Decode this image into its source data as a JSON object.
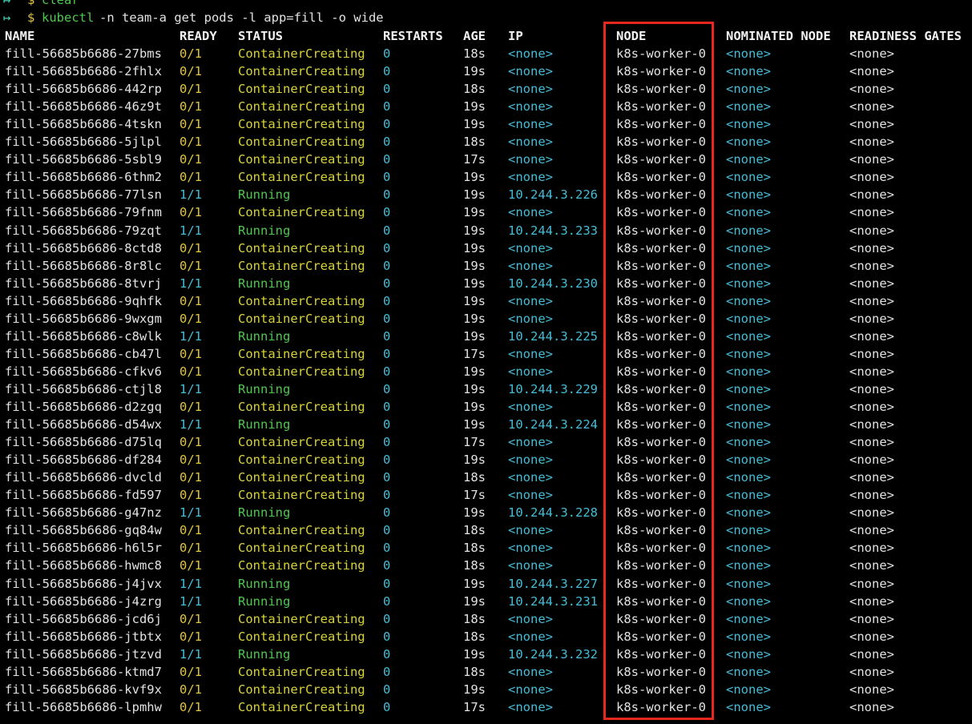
{
  "terminal": {
    "prev_command": {
      "arrow": "↦",
      "dollar": "$",
      "text": "clear"
    },
    "command": {
      "arrow": "↦",
      "dollar": "$",
      "program": "kubectl",
      "args": "-n team-a get pods -l app=fill -o wide"
    },
    "headers": {
      "name": "NAME",
      "ready": "READY",
      "status": "STATUS",
      "restarts": "RESTARTS",
      "age": "AGE",
      "ip": "IP",
      "node": "NODE",
      "nominated_node": "NOMINATED NODE",
      "readiness_gates": "READINESS GATES"
    },
    "highlight_color": "#e8281e",
    "rows": [
      {
        "name": "fill-56685b6686-27bms",
        "ready": "0/1",
        "status": "ContainerCreating",
        "restarts": "0",
        "age": "18s",
        "ip": "<none>",
        "node": "k8s-worker-0",
        "nominated": "<none>",
        "gates": "<none>"
      },
      {
        "name": "fill-56685b6686-2fhlx",
        "ready": "0/1",
        "status": "ContainerCreating",
        "restarts": "0",
        "age": "19s",
        "ip": "<none>",
        "node": "k8s-worker-0",
        "nominated": "<none>",
        "gates": "<none>"
      },
      {
        "name": "fill-56685b6686-442rp",
        "ready": "0/1",
        "status": "ContainerCreating",
        "restarts": "0",
        "age": "18s",
        "ip": "<none>",
        "node": "k8s-worker-0",
        "nominated": "<none>",
        "gates": "<none>"
      },
      {
        "name": "fill-56685b6686-46z9t",
        "ready": "0/1",
        "status": "ContainerCreating",
        "restarts": "0",
        "age": "19s",
        "ip": "<none>",
        "node": "k8s-worker-0",
        "nominated": "<none>",
        "gates": "<none>"
      },
      {
        "name": "fill-56685b6686-4tskn",
        "ready": "0/1",
        "status": "ContainerCreating",
        "restarts": "0",
        "age": "19s",
        "ip": "<none>",
        "node": "k8s-worker-0",
        "nominated": "<none>",
        "gates": "<none>"
      },
      {
        "name": "fill-56685b6686-5jlpl",
        "ready": "0/1",
        "status": "ContainerCreating",
        "restarts": "0",
        "age": "18s",
        "ip": "<none>",
        "node": "k8s-worker-0",
        "nominated": "<none>",
        "gates": "<none>"
      },
      {
        "name": "fill-56685b6686-5sbl9",
        "ready": "0/1",
        "status": "ContainerCreating",
        "restarts": "0",
        "age": "17s",
        "ip": "<none>",
        "node": "k8s-worker-0",
        "nominated": "<none>",
        "gates": "<none>"
      },
      {
        "name": "fill-56685b6686-6thm2",
        "ready": "0/1",
        "status": "ContainerCreating",
        "restarts": "0",
        "age": "19s",
        "ip": "<none>",
        "node": "k8s-worker-0",
        "nominated": "<none>",
        "gates": "<none>"
      },
      {
        "name": "fill-56685b6686-77lsn",
        "ready": "1/1",
        "status": "Running",
        "restarts": "0",
        "age": "19s",
        "ip": "10.244.3.226",
        "node": "k8s-worker-0",
        "nominated": "<none>",
        "gates": "<none>"
      },
      {
        "name": "fill-56685b6686-79fnm",
        "ready": "0/1",
        "status": "ContainerCreating",
        "restarts": "0",
        "age": "19s",
        "ip": "<none>",
        "node": "k8s-worker-0",
        "nominated": "<none>",
        "gates": "<none>"
      },
      {
        "name": "fill-56685b6686-79zqt",
        "ready": "1/1",
        "status": "Running",
        "restarts": "0",
        "age": "19s",
        "ip": "10.244.3.233",
        "node": "k8s-worker-0",
        "nominated": "<none>",
        "gates": "<none>"
      },
      {
        "name": "fill-56685b6686-8ctd8",
        "ready": "0/1",
        "status": "ContainerCreating",
        "restarts": "0",
        "age": "19s",
        "ip": "<none>",
        "node": "k8s-worker-0",
        "nominated": "<none>",
        "gates": "<none>"
      },
      {
        "name": "fill-56685b6686-8r8lc",
        "ready": "0/1",
        "status": "ContainerCreating",
        "restarts": "0",
        "age": "19s",
        "ip": "<none>",
        "node": "k8s-worker-0",
        "nominated": "<none>",
        "gates": "<none>"
      },
      {
        "name": "fill-56685b6686-8tvrj",
        "ready": "1/1",
        "status": "Running",
        "restarts": "0",
        "age": "19s",
        "ip": "10.244.3.230",
        "node": "k8s-worker-0",
        "nominated": "<none>",
        "gates": "<none>"
      },
      {
        "name": "fill-56685b6686-9qhfk",
        "ready": "0/1",
        "status": "ContainerCreating",
        "restarts": "0",
        "age": "19s",
        "ip": "<none>",
        "node": "k8s-worker-0",
        "nominated": "<none>",
        "gates": "<none>"
      },
      {
        "name": "fill-56685b6686-9wxgm",
        "ready": "0/1",
        "status": "ContainerCreating",
        "restarts": "0",
        "age": "19s",
        "ip": "<none>",
        "node": "k8s-worker-0",
        "nominated": "<none>",
        "gates": "<none>"
      },
      {
        "name": "fill-56685b6686-c8wlk",
        "ready": "1/1",
        "status": "Running",
        "restarts": "0",
        "age": "19s",
        "ip": "10.244.3.225",
        "node": "k8s-worker-0",
        "nominated": "<none>",
        "gates": "<none>"
      },
      {
        "name": "fill-56685b6686-cb47l",
        "ready": "0/1",
        "status": "ContainerCreating",
        "restarts": "0",
        "age": "17s",
        "ip": "<none>",
        "node": "k8s-worker-0",
        "nominated": "<none>",
        "gates": "<none>"
      },
      {
        "name": "fill-56685b6686-cfkv6",
        "ready": "0/1",
        "status": "ContainerCreating",
        "restarts": "0",
        "age": "19s",
        "ip": "<none>",
        "node": "k8s-worker-0",
        "nominated": "<none>",
        "gates": "<none>"
      },
      {
        "name": "fill-56685b6686-ctjl8",
        "ready": "1/1",
        "status": "Running",
        "restarts": "0",
        "age": "19s",
        "ip": "10.244.3.229",
        "node": "k8s-worker-0",
        "nominated": "<none>",
        "gates": "<none>"
      },
      {
        "name": "fill-56685b6686-d2zgq",
        "ready": "0/1",
        "status": "ContainerCreating",
        "restarts": "0",
        "age": "19s",
        "ip": "<none>",
        "node": "k8s-worker-0",
        "nominated": "<none>",
        "gates": "<none>"
      },
      {
        "name": "fill-56685b6686-d54wx",
        "ready": "1/1",
        "status": "Running",
        "restarts": "0",
        "age": "19s",
        "ip": "10.244.3.224",
        "node": "k8s-worker-0",
        "nominated": "<none>",
        "gates": "<none>"
      },
      {
        "name": "fill-56685b6686-d75lq",
        "ready": "0/1",
        "status": "ContainerCreating",
        "restarts": "0",
        "age": "17s",
        "ip": "<none>",
        "node": "k8s-worker-0",
        "nominated": "<none>",
        "gates": "<none>"
      },
      {
        "name": "fill-56685b6686-df284",
        "ready": "0/1",
        "status": "ContainerCreating",
        "restarts": "0",
        "age": "19s",
        "ip": "<none>",
        "node": "k8s-worker-0",
        "nominated": "<none>",
        "gates": "<none>"
      },
      {
        "name": "fill-56685b6686-dvcld",
        "ready": "0/1",
        "status": "ContainerCreating",
        "restarts": "0",
        "age": "18s",
        "ip": "<none>",
        "node": "k8s-worker-0",
        "nominated": "<none>",
        "gates": "<none>"
      },
      {
        "name": "fill-56685b6686-fd597",
        "ready": "0/1",
        "status": "ContainerCreating",
        "restarts": "0",
        "age": "17s",
        "ip": "<none>",
        "node": "k8s-worker-0",
        "nominated": "<none>",
        "gates": "<none>"
      },
      {
        "name": "fill-56685b6686-g47nz",
        "ready": "1/1",
        "status": "Running",
        "restarts": "0",
        "age": "19s",
        "ip": "10.244.3.228",
        "node": "k8s-worker-0",
        "nominated": "<none>",
        "gates": "<none>"
      },
      {
        "name": "fill-56685b6686-gq84w",
        "ready": "0/1",
        "status": "ContainerCreating",
        "restarts": "0",
        "age": "18s",
        "ip": "<none>",
        "node": "k8s-worker-0",
        "nominated": "<none>",
        "gates": "<none>"
      },
      {
        "name": "fill-56685b6686-h6l5r",
        "ready": "0/1",
        "status": "ContainerCreating",
        "restarts": "0",
        "age": "18s",
        "ip": "<none>",
        "node": "k8s-worker-0",
        "nominated": "<none>",
        "gates": "<none>"
      },
      {
        "name": "fill-56685b6686-hwmc8",
        "ready": "0/1",
        "status": "ContainerCreating",
        "restarts": "0",
        "age": "18s",
        "ip": "<none>",
        "node": "k8s-worker-0",
        "nominated": "<none>",
        "gates": "<none>"
      },
      {
        "name": "fill-56685b6686-j4jvx",
        "ready": "1/1",
        "status": "Running",
        "restarts": "0",
        "age": "19s",
        "ip": "10.244.3.227",
        "node": "k8s-worker-0",
        "nominated": "<none>",
        "gates": "<none>"
      },
      {
        "name": "fill-56685b6686-j4zrg",
        "ready": "1/1",
        "status": "Running",
        "restarts": "0",
        "age": "19s",
        "ip": "10.244.3.231",
        "node": "k8s-worker-0",
        "nominated": "<none>",
        "gates": "<none>"
      },
      {
        "name": "fill-56685b6686-jcd6j",
        "ready": "0/1",
        "status": "ContainerCreating",
        "restarts": "0",
        "age": "18s",
        "ip": "<none>",
        "node": "k8s-worker-0",
        "nominated": "<none>",
        "gates": "<none>"
      },
      {
        "name": "fill-56685b6686-jtbtx",
        "ready": "0/1",
        "status": "ContainerCreating",
        "restarts": "0",
        "age": "18s",
        "ip": "<none>",
        "node": "k8s-worker-0",
        "nominated": "<none>",
        "gates": "<none>"
      },
      {
        "name": "fill-56685b6686-jtzvd",
        "ready": "1/1",
        "status": "Running",
        "restarts": "0",
        "age": "19s",
        "ip": "10.244.3.232",
        "node": "k8s-worker-0",
        "nominated": "<none>",
        "gates": "<none>"
      },
      {
        "name": "fill-56685b6686-ktmd7",
        "ready": "0/1",
        "status": "ContainerCreating",
        "restarts": "0",
        "age": "18s",
        "ip": "<none>",
        "node": "k8s-worker-0",
        "nominated": "<none>",
        "gates": "<none>"
      },
      {
        "name": "fill-56685b6686-kvf9x",
        "ready": "0/1",
        "status": "ContainerCreating",
        "restarts": "0",
        "age": "19s",
        "ip": "<none>",
        "node": "k8s-worker-0",
        "nominated": "<none>",
        "gates": "<none>"
      },
      {
        "name": "fill-56685b6686-lpmhw",
        "ready": "0/1",
        "status": "ContainerCreating",
        "restarts": "0",
        "age": "17s",
        "ip": "<none>",
        "node": "k8s-worker-0",
        "nominated": "<none>",
        "gates": "<none>"
      }
    ]
  }
}
